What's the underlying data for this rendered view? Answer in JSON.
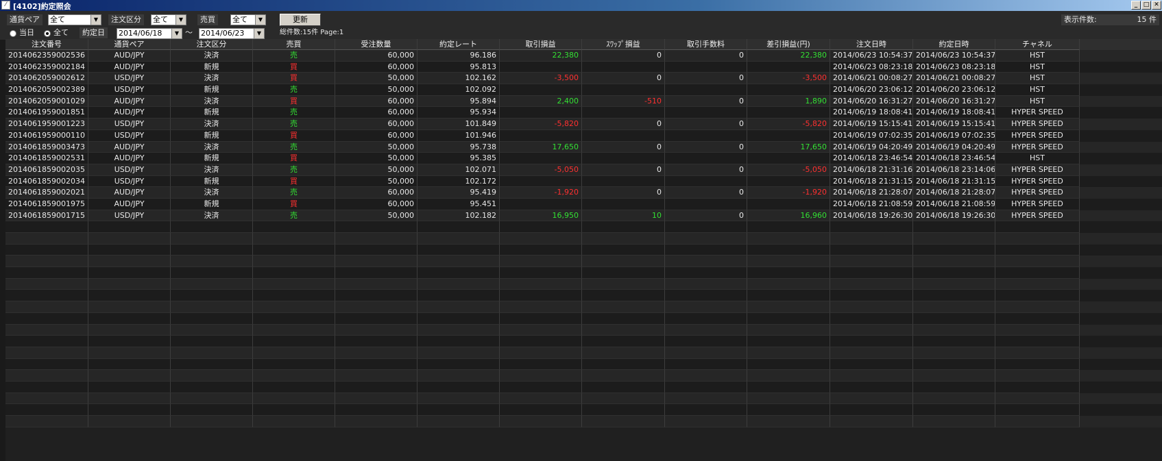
{
  "window": {
    "title": "[4102]約定照会",
    "icon": "app-icon"
  },
  "filters": {
    "currency_pair_label": "通貨ペア",
    "currency_pair_value": "全て",
    "order_type_label": "注文区分",
    "order_type_value": "全て",
    "side_label": "売買",
    "side_value": "全て",
    "refresh_label": "更新",
    "display_count_label": "表示件数:",
    "display_count_value": "15 件",
    "radio_today_label": "当日",
    "radio_all_label": "全て",
    "radio_selected": "all",
    "date_label": "約定日",
    "date_from": "2014/06/18",
    "date_tilde": "～",
    "date_to": "2014/06/23",
    "summary": "総件数:15件 Page:1"
  },
  "colors": {
    "positive": "#33e033",
    "negative": "#ff3030"
  },
  "table": {
    "columns": [
      "注文番号",
      "通貨ペア",
      "注文区分",
      "売買",
      "受注数量",
      "約定レート",
      "取引損益",
      "ｽﾜｯﾌﾟ損益",
      "取引手数料",
      "差引損益(円)",
      "注文日時",
      "約定日時",
      "チャネル"
    ],
    "rows": [
      [
        "2014062359002536",
        "AUD/JPY",
        "決済",
        "売",
        "60,000",
        "96.186",
        "22,380",
        "0",
        "0",
        "22,380",
        "2014/06/23 10:54:37",
        "2014/06/23 10:54:37",
        "HST"
      ],
      [
        "2014062359002184",
        "AUD/JPY",
        "新規",
        "買",
        "60,000",
        "95.813",
        "",
        "",
        "",
        "",
        "2014/06/23 08:23:18",
        "2014/06/23 08:23:18",
        "HST"
      ],
      [
        "2014062059002612",
        "USD/JPY",
        "決済",
        "買",
        "50,000",
        "102.162",
        "-3,500",
        "0",
        "0",
        "-3,500",
        "2014/06/21 00:08:27",
        "2014/06/21 00:08:27",
        "HST"
      ],
      [
        "2014062059002389",
        "USD/JPY",
        "新規",
        "売",
        "50,000",
        "102.092",
        "",
        "",
        "",
        "",
        "2014/06/20 23:06:12",
        "2014/06/20 23:06:12",
        "HST"
      ],
      [
        "2014062059001029",
        "AUD/JPY",
        "決済",
        "買",
        "60,000",
        "95.894",
        "2,400",
        "-510",
        "0",
        "1,890",
        "2014/06/20 16:31:27",
        "2014/06/20 16:31:27",
        "HST"
      ],
      [
        "2014061959001851",
        "AUD/JPY",
        "新規",
        "売",
        "60,000",
        "95.934",
        "",
        "",
        "",
        "",
        "2014/06/19 18:08:41",
        "2014/06/19 18:08:41",
        "HYPER SPEED"
      ],
      [
        "2014061959001223",
        "USD/JPY",
        "決済",
        "売",
        "60,000",
        "101.849",
        "-5,820",
        "0",
        "0",
        "-5,820",
        "2014/06/19 15:15:41",
        "2014/06/19 15:15:41",
        "HYPER SPEED"
      ],
      [
        "2014061959000110",
        "USD/JPY",
        "新規",
        "買",
        "60,000",
        "101.946",
        "",
        "",
        "",
        "",
        "2014/06/19 07:02:35",
        "2014/06/19 07:02:35",
        "HYPER SPEED"
      ],
      [
        "2014061859003473",
        "AUD/JPY",
        "決済",
        "売",
        "50,000",
        "95.738",
        "17,650",
        "0",
        "0",
        "17,650",
        "2014/06/19 04:20:49",
        "2014/06/19 04:20:49",
        "HYPER SPEED"
      ],
      [
        "2014061859002531",
        "AUD/JPY",
        "新規",
        "買",
        "50,000",
        "95.385",
        "",
        "",
        "",
        "",
        "2014/06/18 23:46:54",
        "2014/06/18 23:46:54",
        "HST"
      ],
      [
        "2014061859002035",
        "USD/JPY",
        "決済",
        "売",
        "50,000",
        "102.071",
        "-5,050",
        "0",
        "0",
        "-5,050",
        "2014/06/18 21:31:16",
        "2014/06/18 23:14:06",
        "HYPER SPEED"
      ],
      [
        "2014061859002034",
        "USD/JPY",
        "新規",
        "買",
        "50,000",
        "102.172",
        "",
        "",
        "",
        "",
        "2014/06/18 21:31:15",
        "2014/06/18 21:31:15",
        "HYPER SPEED"
      ],
      [
        "2014061859002021",
        "AUD/JPY",
        "決済",
        "売",
        "60,000",
        "95.419",
        "-1,920",
        "0",
        "0",
        "-1,920",
        "2014/06/18 21:28:07",
        "2014/06/18 21:28:07",
        "HYPER SPEED"
      ],
      [
        "2014061859001975",
        "AUD/JPY",
        "新規",
        "買",
        "60,000",
        "95.451",
        "",
        "",
        "",
        "",
        "2014/06/18 21:08:59",
        "2014/06/18 21:08:59",
        "HYPER SPEED"
      ],
      [
        "2014061859001715",
        "USD/JPY",
        "決済",
        "売",
        "50,000",
        "102.182",
        "16,950",
        "10",
        "0",
        "16,960",
        "2014/06/18 19:26:30",
        "2014/06/18 19:26:30",
        "HYPER SPEED"
      ]
    ]
  }
}
